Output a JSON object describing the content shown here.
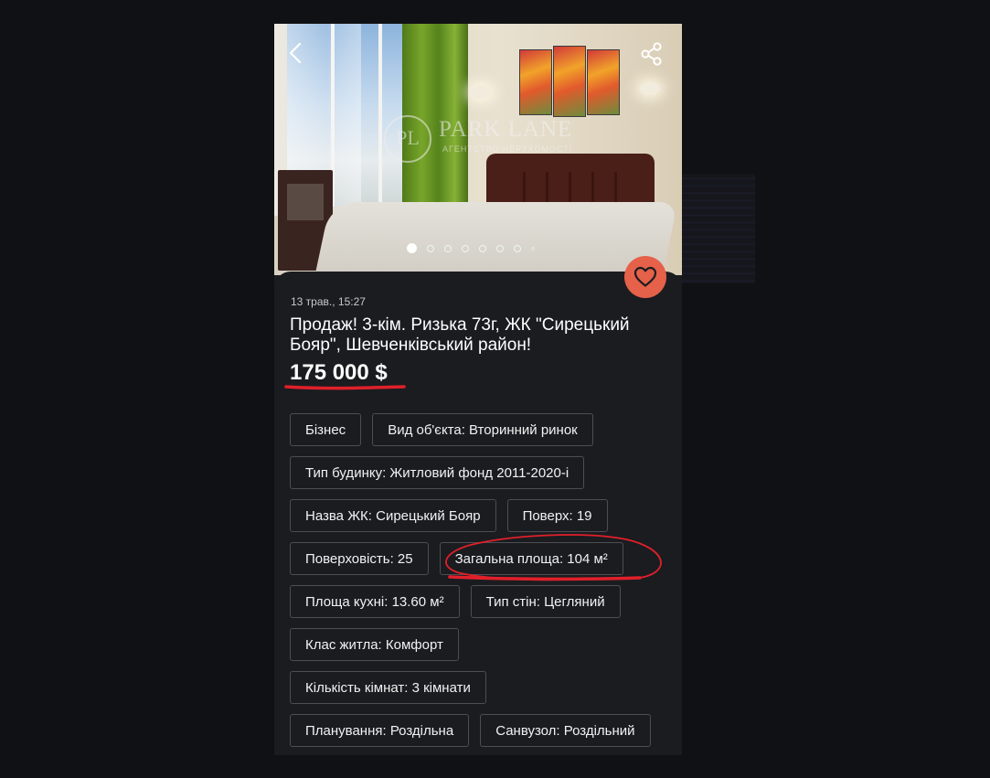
{
  "gallery": {
    "watermark_monogram": "PL",
    "watermark_title": "PARK LANE",
    "watermark_subtitle": "АГЕНТСТВО НЕРУХОМОСТІ",
    "dots_total": 8,
    "active_dot_index": 0
  },
  "listing": {
    "date": "13 трав., 15:27",
    "title": "Продаж! 3-кім. Ризька 73г, ЖК \"Сирецький Бояр\", Шевченківський район!",
    "price": "175 000 $"
  },
  "chips": [
    [
      "Бізнес",
      "Вид об'єкта: Вторинний ринок"
    ],
    [
      "Тип будинку: Житловий фонд 2011-2020-і"
    ],
    [
      "Назва ЖК: Сирецький Бояр",
      "Поверх: 19"
    ],
    [
      "Поверховість: 25",
      "Загальна площа: 104 м²"
    ],
    [
      "Площа кухні: 13.60 м²",
      "Тип стін: Цегляний"
    ],
    [
      "Клас житла: Комфорт"
    ],
    [
      "Кількість кімнат: 3 кімнати"
    ],
    [
      "Планування: Роздільна",
      "Санвузол: Роздільний"
    ]
  ],
  "icons": {
    "back": "chevron-left-icon",
    "share": "share-icon",
    "favorite": "heart-icon"
  },
  "colors": {
    "background": "#101114",
    "card": "#1b1c20",
    "favorite_button": "#e5614a",
    "annotation": "#e0202a"
  }
}
